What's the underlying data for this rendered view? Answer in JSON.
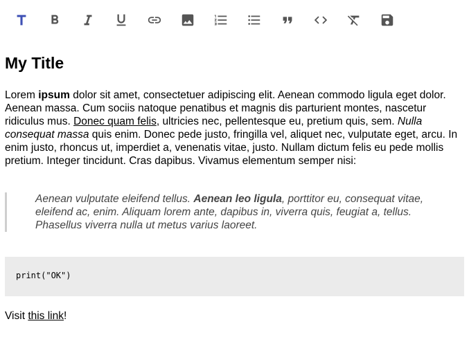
{
  "toolbar": {
    "accent_color": "#3f51b5",
    "icon_color": "#555555",
    "buttons": [
      {
        "name": "text-format-icon",
        "active": true
      },
      {
        "name": "bold-icon",
        "active": false
      },
      {
        "name": "italic-icon",
        "active": false
      },
      {
        "name": "underline-icon",
        "active": false
      },
      {
        "name": "link-icon",
        "active": false
      },
      {
        "name": "image-icon",
        "active": false
      },
      {
        "name": "ordered-list-icon",
        "active": false
      },
      {
        "name": "bullet-list-icon",
        "active": false
      },
      {
        "name": "quote-icon",
        "active": false
      },
      {
        "name": "code-icon",
        "active": false
      },
      {
        "name": "clear-format-icon",
        "active": false
      },
      {
        "name": "save-icon",
        "active": false
      }
    ]
  },
  "document": {
    "title": "My Title",
    "paragraph": {
      "p1": "Lorem ",
      "bold1": "ipsum",
      "p2": " dolor sit amet, consectetuer adipiscing elit. Aenean commodo ligula eget dolor. Aenean massa. Cum sociis natoque penatibus et magnis dis parturient montes, nascetur ridiculus mus. ",
      "underline1": "Donec quam felis",
      "p3": ", ultricies nec, pellentesque eu, pretium quis, sem. ",
      "italic1": "Nulla consequat massa",
      "p4": " quis enim. Donec pede justo, fringilla vel, aliquet nec, vulputate eget, arcu. In enim justo, rhoncus ut, imperdiet a, venenatis vitae, justo. Nullam dictum felis eu pede mollis pretium. Integer tincidunt. Cras dapibus. Vivamus elementum semper nisi:"
    },
    "blockquote": {
      "q1": "Aenean vulputate eleifend tellus. ",
      "bold1": "Aenean leo ligula",
      "q2": ", porttitor eu, consequat vitae, eleifend ac, enim. Aliquam lorem ante, dapibus in, viverra quis, feugiat a, tellus. Phasellus viverra nulla ut metus varius laoreet."
    },
    "code": "print(\"OK\")",
    "visit": {
      "prefix": "Visit ",
      "link_text": "this link",
      "suffix": "!"
    }
  }
}
